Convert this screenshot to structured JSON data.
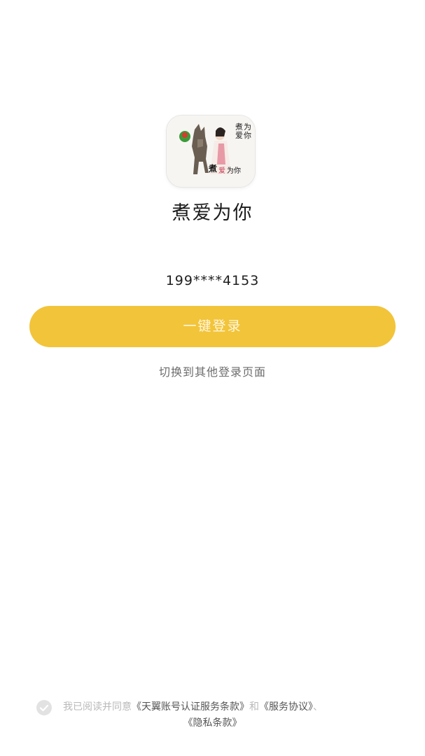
{
  "app": {
    "name": "煮爱为你",
    "icon": "app-logo-icon"
  },
  "login": {
    "phone_masked": "199****4153",
    "one_click_label": "一键登录",
    "switch_label": "切换到其他登录页面"
  },
  "agreement": {
    "checkbox_icon": "check-icon",
    "prefix": "我已阅读并同意",
    "terms_auth": "《天翼账号认证服务条款》",
    "and": "和",
    "terms_service": "《服务协议》",
    "separator": "、",
    "terms_privacy": "《隐私条款》"
  },
  "colors": {
    "accent": "#f2c43a",
    "background": "#ffffff"
  }
}
